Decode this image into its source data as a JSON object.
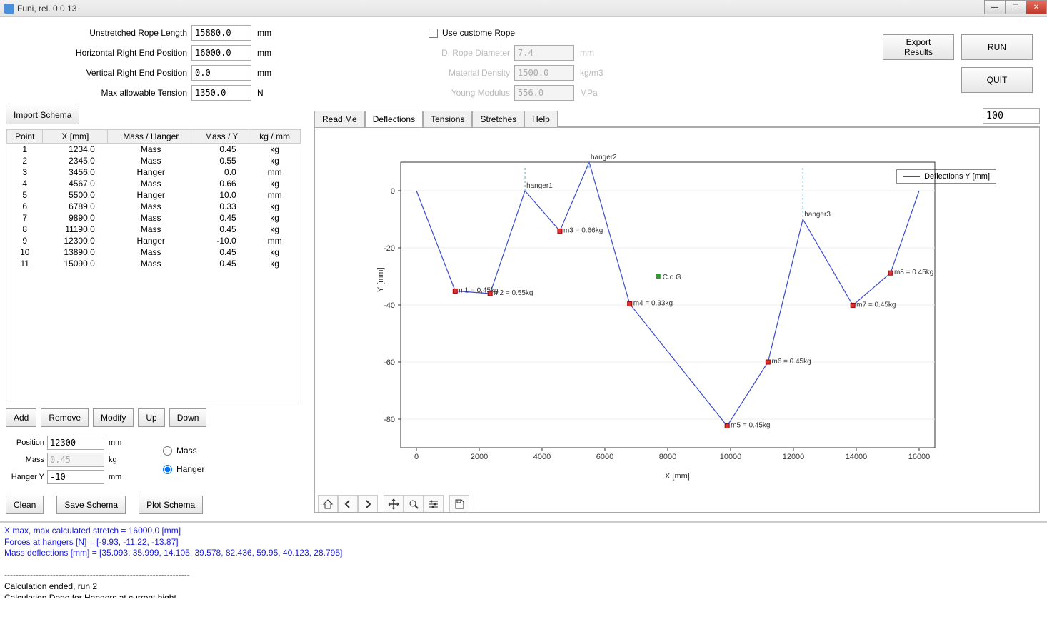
{
  "window": {
    "title": "Funi, rel. 0.0.13"
  },
  "params": {
    "unstretched": {
      "label": "Unstretched Rope Length",
      "value": "15880.0",
      "unit": "mm"
    },
    "hrep": {
      "label": "Horizontal Right End Position",
      "value": "16000.0",
      "unit": "mm"
    },
    "vrep": {
      "label": "Vertical Right End Position",
      "value": "0.0",
      "unit": "mm"
    },
    "maxtension": {
      "label": "Max allowable Tension",
      "value": "1350.0",
      "unit": "N"
    }
  },
  "custom_rope": {
    "checkbox_label": "Use custome Rope",
    "diameter": {
      "label": "D, Rope Diameter",
      "value": "7.4",
      "unit": "mm"
    },
    "density": {
      "label": "Material Density",
      "value": "1500.0",
      "unit": "kg/m3"
    },
    "young": {
      "label": "Young Modulus",
      "value": "556.0",
      "unit": "MPa"
    }
  },
  "buttons": {
    "import_schema": "Import Schema",
    "export_results": "Export Results",
    "run": "RUN",
    "quit": "QUIT",
    "add": "Add",
    "remove": "Remove",
    "modify": "Modify",
    "up": "Up",
    "down": "Down",
    "clean": "Clean",
    "save_schema": "Save Schema",
    "plot_schema": "Plot Schema"
  },
  "table": {
    "headers": {
      "point": "Point",
      "x": "X [mm]",
      "mh": "Mass / Hanger",
      "my": "Mass / Y",
      "kgmm": "kg / mm"
    },
    "rows": [
      {
        "p": "1",
        "x": "1234.0",
        "mh": "Mass",
        "my": "0.45",
        "u": "kg"
      },
      {
        "p": "2",
        "x": "2345.0",
        "mh": "Mass",
        "my": "0.55",
        "u": "kg"
      },
      {
        "p": "3",
        "x": "3456.0",
        "mh": "Hanger",
        "my": "0.0",
        "u": "mm"
      },
      {
        "p": "4",
        "x": "4567.0",
        "mh": "Mass",
        "my": "0.66",
        "u": "kg"
      },
      {
        "p": "5",
        "x": "5500.0",
        "mh": "Hanger",
        "my": "10.0",
        "u": "mm"
      },
      {
        "p": "6",
        "x": "6789.0",
        "mh": "Mass",
        "my": "0.33",
        "u": "kg"
      },
      {
        "p": "7",
        "x": "9890.0",
        "mh": "Mass",
        "my": "0.45",
        "u": "kg"
      },
      {
        "p": "8",
        "x": "11190.0",
        "mh": "Mass",
        "my": "0.45",
        "u": "kg"
      },
      {
        "p": "9",
        "x": "12300.0",
        "mh": "Hanger",
        "my": "-10.0",
        "u": "mm"
      },
      {
        "p": "10",
        "x": "13890.0",
        "mh": "Mass",
        "my": "0.45",
        "u": "kg"
      },
      {
        "p": "11",
        "x": "15090.0",
        "mh": "Mass",
        "my": "0.45",
        "u": "kg"
      }
    ]
  },
  "edit": {
    "position": {
      "label": "Position",
      "value": "12300",
      "unit": "mm"
    },
    "mass": {
      "label": "Mass",
      "value": "0.45",
      "unit": "kg"
    },
    "hangery": {
      "label": "Hanger Y",
      "value": "-10",
      "unit": "mm"
    },
    "radio_mass": "Mass",
    "radio_hanger": "Hanger"
  },
  "tabs": {
    "readme": "Read Me",
    "deflections": "Deflections",
    "tensions": "Tensions",
    "stretches": "Stretches",
    "help": "Help"
  },
  "zoom_value": "100",
  "chart_legend": "Deflections Y [mm]",
  "axis": {
    "x": "X  [mm]",
    "y": "Y  [mm]"
  },
  "annotations": {
    "h1": "hanger1",
    "h2": "hanger2",
    "h3": "hanger3",
    "cog": "C.o.G",
    "m1": "m1 = 0.45kg",
    "m2": "m2 = 0.55kg",
    "m3": "m3 = 0.66kg",
    "m4": "m4 = 0.33kg",
    "m5": "m5 = 0.45kg",
    "m6": "m6 = 0.45kg",
    "m7": "m7 = 0.45kg",
    "m8": "m8 = 0.45kg"
  },
  "log": {
    "l1": "X max, max calculated stretch = 16000.0 [mm]",
    "l2": "Forces at hangers [N] = [-9.93, -11.22, -13.87]",
    "l3": "Mass deflections [mm] = [35.093, 35.999, 14.105, 39.578, 82.436, 59.95, 40.123, 28.795]",
    "sep": "-----------------------------------------------------------------",
    "l4": "Calculation ended, run 2",
    "l5": "Calculation Done for Hangers at current hight"
  },
  "chart_data": {
    "type": "line",
    "xlabel": "X [mm]",
    "ylabel": "Y [mm]",
    "xlim": [
      -500,
      16500
    ],
    "ylim": [
      -90,
      10
    ],
    "xticks": [
      0,
      2000,
      4000,
      6000,
      8000,
      10000,
      12000,
      14000,
      16000
    ],
    "yticks": [
      0,
      -20,
      -40,
      -60,
      -80
    ],
    "series": [
      {
        "name": "Deflections Y [mm]",
        "x": [
          0,
          1234,
          2345,
          3456,
          4567,
          5500,
          6789,
          9890,
          11190,
          12300,
          13890,
          15090,
          16000
        ],
        "y": [
          0,
          -35.1,
          -36.0,
          0.0,
          -14.1,
          10.0,
          -39.6,
          -82.4,
          -60.0,
          -10.0,
          -40.1,
          -28.8,
          0
        ]
      }
    ],
    "markers": [
      {
        "label": "m1",
        "x": 1234,
        "y": -35.1,
        "type": "mass"
      },
      {
        "label": "m2",
        "x": 2345,
        "y": -36.0,
        "type": "mass"
      },
      {
        "label": "hanger1",
        "x": 3456,
        "y": 0.0,
        "type": "hanger"
      },
      {
        "label": "m3",
        "x": 4567,
        "y": -14.1,
        "type": "mass"
      },
      {
        "label": "hanger2",
        "x": 5500,
        "y": 10.0,
        "type": "hanger"
      },
      {
        "label": "m4",
        "x": 6789,
        "y": -39.6,
        "type": "mass"
      },
      {
        "label": "m5",
        "x": 9890,
        "y": -82.4,
        "type": "mass"
      },
      {
        "label": "m6",
        "x": 11190,
        "y": -60.0,
        "type": "mass"
      },
      {
        "label": "hanger3",
        "x": 12300,
        "y": -10.0,
        "type": "hanger"
      },
      {
        "label": "m7",
        "x": 13890,
        "y": -40.1,
        "type": "mass"
      },
      {
        "label": "m8",
        "x": 15090,
        "y": -28.8,
        "type": "mass"
      },
      {
        "label": "C.o.G",
        "x": 7700,
        "y": -30,
        "type": "cog"
      }
    ]
  }
}
